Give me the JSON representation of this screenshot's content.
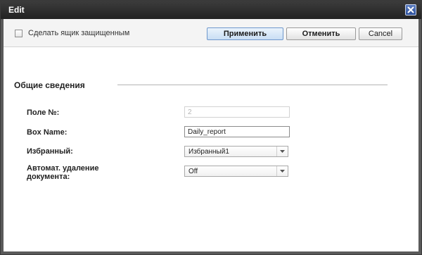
{
  "window": {
    "title": "Edit"
  },
  "toolbar": {
    "protect_checkbox_label": "Сделать ящик защищенным",
    "protect_checked": false,
    "apply_label": "Применить",
    "cancel_ru_label": "Отменить",
    "cancel_en_label": "Cancel"
  },
  "section": {
    "title": "Общие сведения"
  },
  "fields": {
    "slot": {
      "label": "Поле №:",
      "value": "2"
    },
    "box_name": {
      "label": "Box Name:",
      "value": "Daily_report"
    },
    "favorite": {
      "label": "Избранный:",
      "value": "Избранный1"
    },
    "auto_delete": {
      "label": "Автомат. удаление документа:",
      "value": "Off"
    }
  },
  "icons": {
    "close": "close-icon",
    "dropdown": "chevron-down-icon"
  },
  "colors": {
    "titlebar": "#2e2e2e",
    "apply_button": "#c9def4",
    "close_button": "#2b4f9c"
  }
}
